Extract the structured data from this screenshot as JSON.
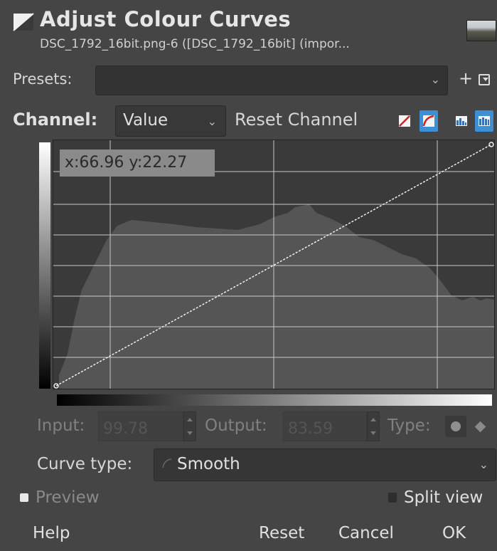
{
  "header": {
    "title": "Adjust Colour Curves",
    "subtitle": "DSC_1792_16bit.png-6 ([DSC_1792_16bit] (impor..."
  },
  "presets": {
    "label": "Presets:",
    "value": "",
    "add_glyph": "+"
  },
  "channel": {
    "label": "Channel:",
    "value": "Value",
    "reset_label": "Reset Channel",
    "curve_mode": {
      "linear_active": false,
      "log_active": true
    },
    "histogram_mode": {
      "linear_active": false,
      "log_active": true
    }
  },
  "graph": {
    "coords_readout": "x:66.96 y:22.27",
    "curve_points": [
      [
        0,
        0
      ],
      [
        100,
        100
      ]
    ]
  },
  "point": {
    "input_label": "Input:",
    "input_value": "99.78",
    "output_label": "Output:",
    "output_value": "83.59",
    "type_label": "Type:"
  },
  "curve_type": {
    "label": "Curve type:",
    "value": "Smooth"
  },
  "options": {
    "preview_label": "Preview",
    "preview_checked": true,
    "split_label": "Split view",
    "split_checked": false
  },
  "buttons": {
    "help": "Help",
    "reset": "Reset",
    "cancel": "Cancel",
    "ok": "OK"
  },
  "colors": {
    "background": "#454545",
    "accent": "#3d8fd6"
  }
}
